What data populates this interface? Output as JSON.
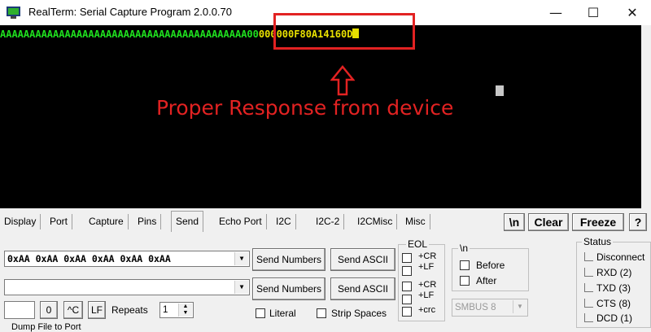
{
  "window": {
    "title": "RealTerm: Serial Capture Program 2.0.0.70",
    "controls": {
      "minimize": "—",
      "maximize": "☐",
      "close": "✕"
    }
  },
  "terminal": {
    "rx_green": "AAAAAAAAAAAAAAAAAAAAAAAAAAAAAAAAAAAAAAAAAA00",
    "rx_yellow": "000000F80A14160D",
    "annotation": "Proper Response from device",
    "colors": {
      "annotation": "#e22222",
      "rx_green": "#1fe01f",
      "rx_yellow": "#e8e000"
    }
  },
  "tabs": [
    "Display",
    "Port",
    "Capture",
    "Pins",
    "Send",
    "Echo Port",
    "I2C",
    "I2C-2",
    "I2CMisc",
    "Misc"
  ],
  "active_tab": "Send",
  "toolbar": {
    "newline": "\\n",
    "clear": "Clear",
    "freeze": "Freeze",
    "help": "?"
  },
  "send": {
    "row1_value": "0xAA 0xAA 0xAA 0xAA 0xAA 0xAA",
    "row2_value": "",
    "send_numbers_1": "Send Numbers",
    "send_ascii_1": "Send ASCII",
    "send_numbers_2": "Send Numbers",
    "send_ascii_2": "Send ASCII",
    "zero": "0",
    "ctrl_c": "^C",
    "lf": "LF",
    "repeats_label": "Repeats",
    "repeats_value": "1",
    "literal": "Literal",
    "strip_spaces": "Strip Spaces",
    "eol_group": "EOL",
    "eol_items": [
      "+CR",
      "+LF",
      "+CR",
      "+LF"
    ],
    "eol_crc": "+crc",
    "nl_group": "\\n",
    "before": "Before",
    "after": "After",
    "smbus": "SMBUS 8",
    "dump_label": "Dump File to Port"
  },
  "status": {
    "title": "Status",
    "items": [
      "Disconnect",
      "RXD (2)",
      "TXD (3)",
      "CTS (8)",
      "DCD (1)"
    ]
  }
}
